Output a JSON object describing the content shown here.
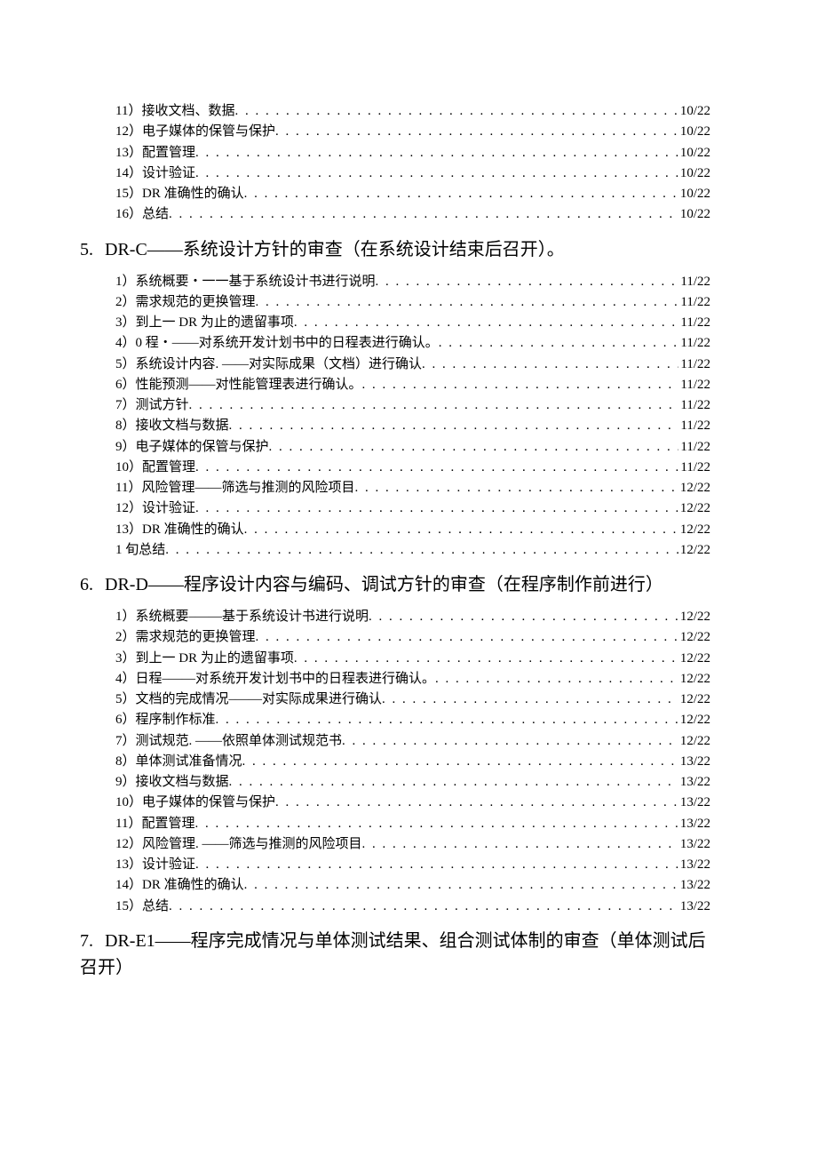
{
  "blocks": [
    {
      "type": "toc",
      "items": [
        {
          "label": "11）接收文档、数据",
          "page": "10/22"
        },
        {
          "label": "12）电子媒体的保管与保护",
          "page": "10/22"
        },
        {
          "label": "13）配置管理",
          "page": "10/22"
        },
        {
          "label": "14）设计验证",
          "page": "10/22"
        },
        {
          "label": "15）DR 准确性的确认",
          "page": "10/22"
        },
        {
          "label": "16）总结",
          "page": "10/22"
        }
      ]
    },
    {
      "type": "heading",
      "num": "5.",
      "text": "DR-C——系统设计方针的审查（在系统设计结束后召开）。"
    },
    {
      "type": "toc",
      "items": [
        {
          "label": "1）系统概要・一一基于系统设计书进行说明",
          "page": "11/22"
        },
        {
          "label": "2）需求规范的更换管理",
          "page": "11/22"
        },
        {
          "label": "3）到上一 DR 为止的遗留事项",
          "page": "11/22"
        },
        {
          "label": "4）0 程・——对系统开发计划书中的日程表进行确认。",
          "page": "11/22"
        },
        {
          "label": "5）系统设计内容. ——对实际成果（文档）进行确认",
          "page": "11/22"
        },
        {
          "label": "6）性能预测——对性能管理表进行确认。",
          "page": "11/22"
        },
        {
          "label": "7）测试方针",
          "page": "11/22"
        },
        {
          "label": "8）接收文档与数据",
          "page": "11/22"
        },
        {
          "label": "9）电子媒体的保管与保护",
          "page": "11/22"
        },
        {
          "label": "10）配置管理",
          "page": "11/22"
        },
        {
          "label": "11）风险管理——筛选与推测的风险项目",
          "page": "12/22"
        },
        {
          "label": "12）设计验证",
          "page": "12/22"
        },
        {
          "label": "13）DR 准确性的确认",
          "page": "12/22"
        },
        {
          "label": "1 旬总结",
          "page": "12/22"
        }
      ]
    },
    {
      "type": "heading",
      "num": "6.",
      "text": "DR-D——程序设计内容与编码、调试方针的审查（在程序制作前进行）"
    },
    {
      "type": "toc",
      "items": [
        {
          "label": "1）系统概要–——基于系统设计书进行说明",
          "page": "12/22"
        },
        {
          "label": "2）需求规范的更换管理",
          "page": "12/22"
        },
        {
          "label": "3）到上一 DR 为止的遗留事项",
          "page": "12/22"
        },
        {
          "label": "4）日程–——对系统开发计划书中的日程表进行确认。",
          "page": "12/22"
        },
        {
          "label": "5）文档的完成情况–——对实际成果进行确认",
          "page": "12/22"
        },
        {
          "label": "6）程序制作标准",
          "page": "12/22"
        },
        {
          "label": "7）测试规范. ——依照单体测试规范书",
          "page": "12/22"
        },
        {
          "label": "8）单体测试准备情况",
          "page": "13/22"
        },
        {
          "label": "9）接收文档与数据",
          "page": "13/22"
        },
        {
          "label": "10）电子媒体的保管与保护",
          "page": "13/22"
        },
        {
          "label": "11）配置管理",
          "page": "13/22"
        },
        {
          "label": "12）风险管理. ——筛选与推测的风险项目",
          "page": "13/22"
        },
        {
          "label": "13）设计验证",
          "page": "13/22"
        },
        {
          "label": "14）DR 准确性的确认",
          "page": "13/22"
        },
        {
          "label": "15）总结",
          "page": "13/22"
        }
      ]
    },
    {
      "type": "heading",
      "num": "7.",
      "text": "DR-E1——程序完成情况与单体测试结果、组合测试体制的审查（单体测试后召开）"
    }
  ]
}
